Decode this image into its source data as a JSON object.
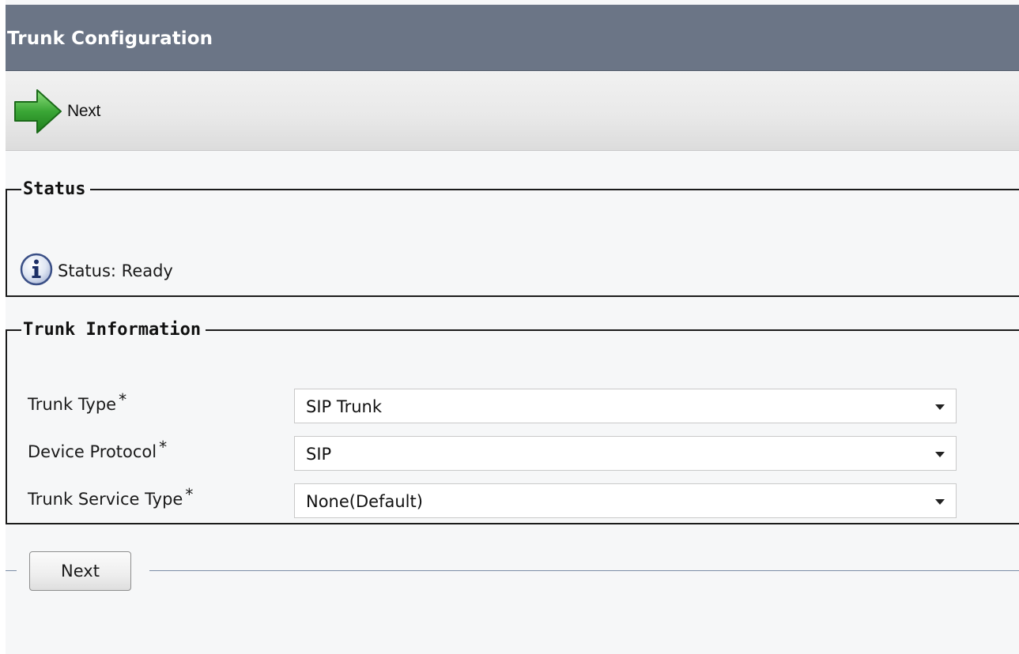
{
  "title_bar": {
    "title": "Trunk Configuration"
  },
  "toolbar": {
    "next_label": "Next",
    "next_icon": "green-arrow-right-icon"
  },
  "status_section": {
    "legend": "Status",
    "icon": "info-icon",
    "message": "Status: Ready"
  },
  "trunk_information": {
    "legend": "Trunk Information",
    "required_marker": "*",
    "fields": [
      {
        "label": "Trunk Type",
        "value": "SIP Trunk"
      },
      {
        "label": "Device Protocol",
        "value": "SIP"
      },
      {
        "label": "Trunk Service Type",
        "value": "None(Default)"
      }
    ]
  },
  "footer": {
    "next_button_label": "Next"
  },
  "colors": {
    "title_bar_bg": "#6b7586",
    "arrow_green": "#3aa635",
    "info_icon_blue": "#3a4f86"
  }
}
